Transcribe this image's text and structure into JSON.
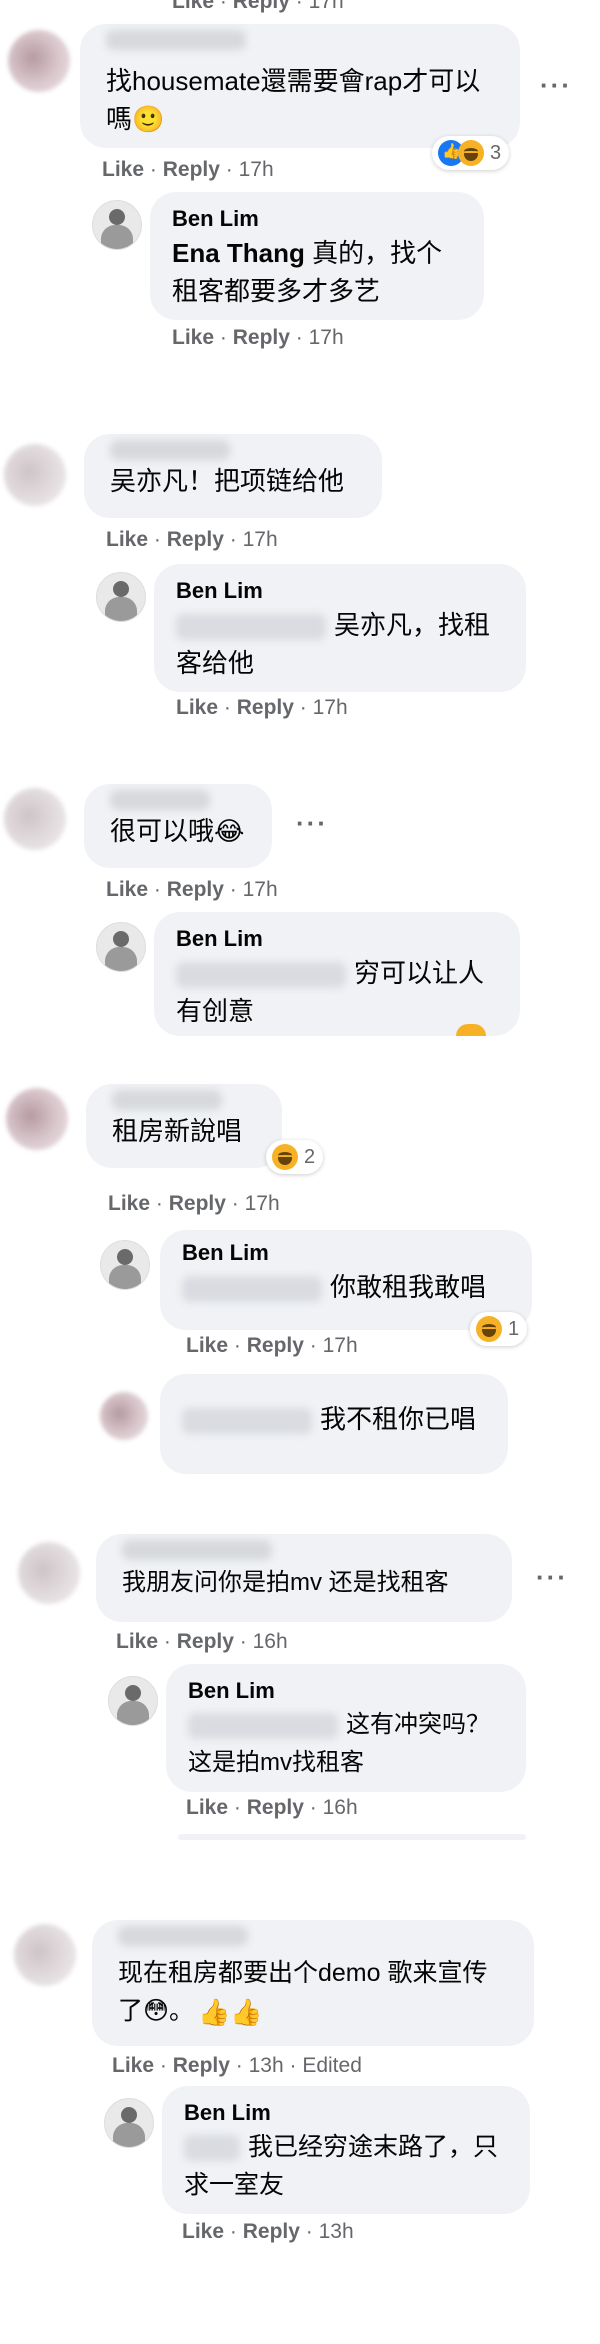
{
  "like_label": "Like",
  "reply_label": "Reply",
  "dot": "·",
  "ellipsis": "···",
  "comments": [
    {
      "text": "找housemate還需要會rap才可以嗎🙂",
      "time": "17h",
      "reaction_count": "3",
      "reply": {
        "name": "Ben Lim",
        "mention": "Ena Thang",
        "text": "真的，找个租客都要多才多艺",
        "time": "17h"
      }
    },
    {
      "text": "吴亦凡！把项链给他",
      "time": "17h",
      "reply": {
        "name": "Ben Lim",
        "text": "吴亦凡，找租客给他",
        "time": "17h"
      }
    },
    {
      "text": "很可以哦😂",
      "time": "17h",
      "reply": {
        "name": "Ben Lim",
        "text": "穷可以让人有创意",
        "time": ""
      }
    },
    {
      "text": "租房新說唱",
      "time": "17h",
      "reaction_count": "2",
      "reply": {
        "name": "Ben Lim",
        "text": "你敢租我敢唱",
        "time": "17h",
        "reaction_count": "1"
      },
      "reply2": {
        "text": "我不租你已唱"
      }
    },
    {
      "text": "我朋友问你是拍mv 还是找租客",
      "time": "16h",
      "reply": {
        "name": "Ben Lim",
        "text": "这有冲突吗？这是拍mv找租客",
        "time": "16h"
      }
    },
    {
      "text": "现在租房都要出个demo 歌来宣传了😳。",
      "time": "13h",
      "edited": "Edited",
      "reply": {
        "name": "Ben Lim",
        "text": "我已经穷途末路了，只求一室友",
        "time": "13h"
      }
    }
  ],
  "top_meta_time": "17h"
}
